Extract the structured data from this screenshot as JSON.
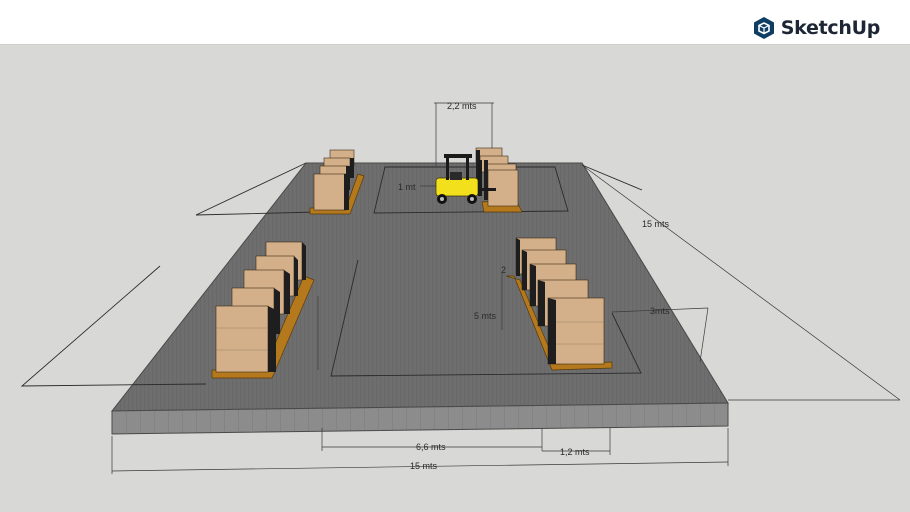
{
  "app": {
    "brand_name": "SketchUp",
    "brand_icon": "sketchup-logo-icon",
    "brand_color": "#0e3d64"
  },
  "scene": {
    "floor_color": "#6e6e6e",
    "floor_edge_color": "#8c8c8c",
    "pallet_color": "#b5791d",
    "box_color": "#d3b089",
    "forklift_color": "#f2e01c",
    "dimensions": {
      "forklift_width": "2,2 mts",
      "forklift_depth": "1 mt",
      "side_depth": "15 mts",
      "aisle_short": "2",
      "aisle_length": "5 mts",
      "rack_gap": "3mts",
      "aisle_width": "6,6 mts",
      "rack_width": "1,2 mts",
      "total_width": "15 mts"
    }
  }
}
